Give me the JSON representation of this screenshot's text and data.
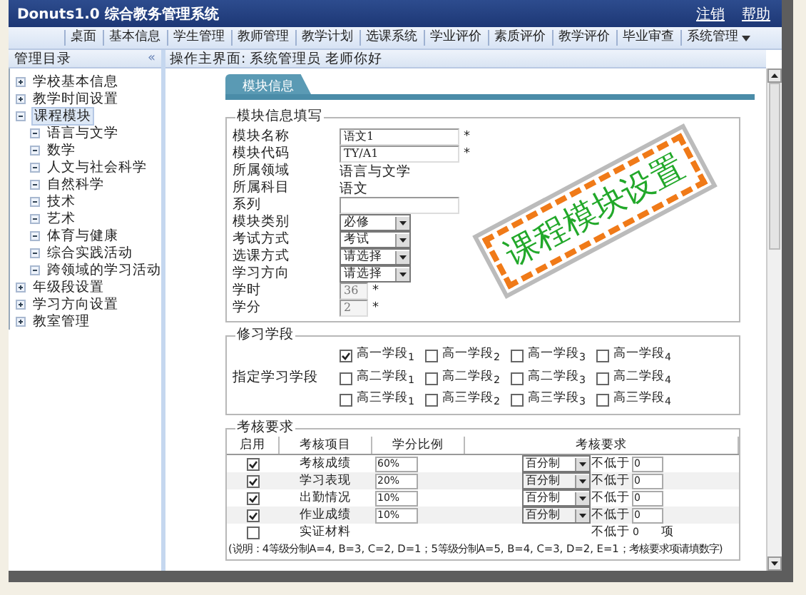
{
  "window": {
    "title": "Donuts1.0 综合教务管理系统",
    "links": [
      "注销",
      "帮助"
    ]
  },
  "menu": [
    {
      "label": "桌面",
      "dropdown": false
    },
    {
      "label": "基本信息",
      "dropdown": false
    },
    {
      "label": "学生管理",
      "dropdown": false
    },
    {
      "label": "教师管理",
      "dropdown": false
    },
    {
      "label": "教学计划",
      "dropdown": false
    },
    {
      "label": "选课系统",
      "dropdown": false
    },
    {
      "label": "学业评价",
      "dropdown": false
    },
    {
      "label": "素质评价",
      "dropdown": false
    },
    {
      "label": "教学评价",
      "dropdown": false
    },
    {
      "label": "毕业审查",
      "dropdown": false
    },
    {
      "label": "系统管理",
      "dropdown": true
    }
  ],
  "sidebar": {
    "title": "管理目录",
    "collapse": "«",
    "items": [
      {
        "label": "学校基本信息",
        "expanded": false,
        "selected": false
      },
      {
        "label": "教学时间设置",
        "expanded": false,
        "selected": false
      },
      {
        "label": "课程模块",
        "expanded": true,
        "selected": true,
        "children": [
          {
            "label": "语言与文学"
          },
          {
            "label": "数学"
          },
          {
            "label": "人文与社会科学"
          },
          {
            "label": "自然科学"
          },
          {
            "label": "技术"
          },
          {
            "label": "艺术"
          },
          {
            "label": "体育与健康"
          },
          {
            "label": "综合实践活动"
          },
          {
            "label": "跨领域的学习活动"
          }
        ]
      },
      {
        "label": "年级段设置",
        "expanded": false,
        "selected": false
      },
      {
        "label": "学习方向设置",
        "expanded": false,
        "selected": false
      },
      {
        "label": "教室管理",
        "expanded": false,
        "selected": false
      }
    ]
  },
  "breadcrumb": "操作主界面: 系统管理员 老师你好",
  "tabs": [
    {
      "label": "模块信息",
      "selected": true
    }
  ],
  "module_info": {
    "legend": "模块信息填写",
    "fields": [
      {
        "label": "模块名称",
        "kind": "input",
        "value": "语文1",
        "mark": "*",
        "disabled": false
      },
      {
        "label": "模块代码",
        "kind": "input",
        "value": "TY/A1",
        "mark": "*",
        "disabled": false
      },
      {
        "label": "所属领域",
        "kind": "text",
        "value": "语言与文学"
      },
      {
        "label": "所属科目",
        "kind": "text",
        "value": "语文"
      },
      {
        "label": "系列",
        "kind": "input",
        "disabled": false
      },
      {
        "label": "模块类别",
        "kind": "select",
        "value": "必修"
      },
      {
        "label": "考试方式",
        "kind": "select",
        "value": "考试"
      },
      {
        "label": "选课方式",
        "kind": "select",
        "value": "请选择"
      },
      {
        "label": "学习方向",
        "kind": "select",
        "value": "请选择"
      },
      {
        "label": "学时",
        "kind": "input",
        "value": "36",
        "mark": "*",
        "disabled": true
      },
      {
        "label": "学分",
        "kind": "input",
        "value": "2",
        "mark": "*",
        "disabled": true
      }
    ]
  },
  "stamp": "课程模块设置",
  "study_stages": {
    "legend": "修习学段",
    "label": "指定学习学段",
    "options": [
      {
        "label": "高一学段$_{1}$",
        "checked": true
      },
      {
        "label": "高一学段$_{2}$",
        "checked": false
      },
      {
        "label": "高一学段$_{3}$",
        "checked": false
      },
      {
        "label": "高一学段$_{4}$",
        "checked": false
      },
      {
        "label": "高二学段$_{1}$",
        "checked": false
      },
      {
        "label": "高二学段$_{2}$",
        "checked": false
      },
      {
        "label": "高二学段$_{3}$",
        "checked": false
      },
      {
        "label": "高二学段$_{4}$",
        "checked": false
      },
      {
        "label": "高三学段$_{1}$",
        "checked": false
      },
      {
        "label": "高三学段$_{2}$",
        "checked": false
      },
      {
        "label": "高三学段$_{3}$",
        "checked": false
      },
      {
        "label": "高三学段$_{4}$",
        "checked": false
      }
    ]
  },
  "assessment": {
    "legend": "考核要求",
    "columns": [
      "启用",
      "考核项目",
      "学分比例",
      "考核要求"
    ],
    "rows": [
      {
        "kind": "score",
        "enabled": true,
        "item": "考核成绩",
        "ratio": "60%",
        "scale": "百分制",
        "min_label": "不低于",
        "min": "0"
      },
      {
        "kind": "score",
        "enabled": true,
        "item": "学习表现",
        "ratio": "20%",
        "scale": "百分制",
        "min_label": "不低于",
        "min": "0"
      },
      {
        "kind": "score",
        "enabled": true,
        "item": "出勤情况",
        "ratio": "10%",
        "scale": "百分制",
        "min_label": "不低于",
        "min": "0"
      },
      {
        "kind": "score",
        "enabled": true,
        "item": "作业成绩",
        "ratio": "10%",
        "scale": "百分制",
        "min_label": "不低于",
        "min": "0"
      },
      {
        "kind": "count",
        "enabled": false,
        "item": "实证材料",
        "min_label": "不低于",
        "min": "0",
        "unit": "项"
      }
    ],
    "note": "(说明：4等级分制A=4, B=3, C=2, D=1；5等级分制A=5, B=4, C=3, D=2, E=1；考核要求项请填数字)"
  }
}
